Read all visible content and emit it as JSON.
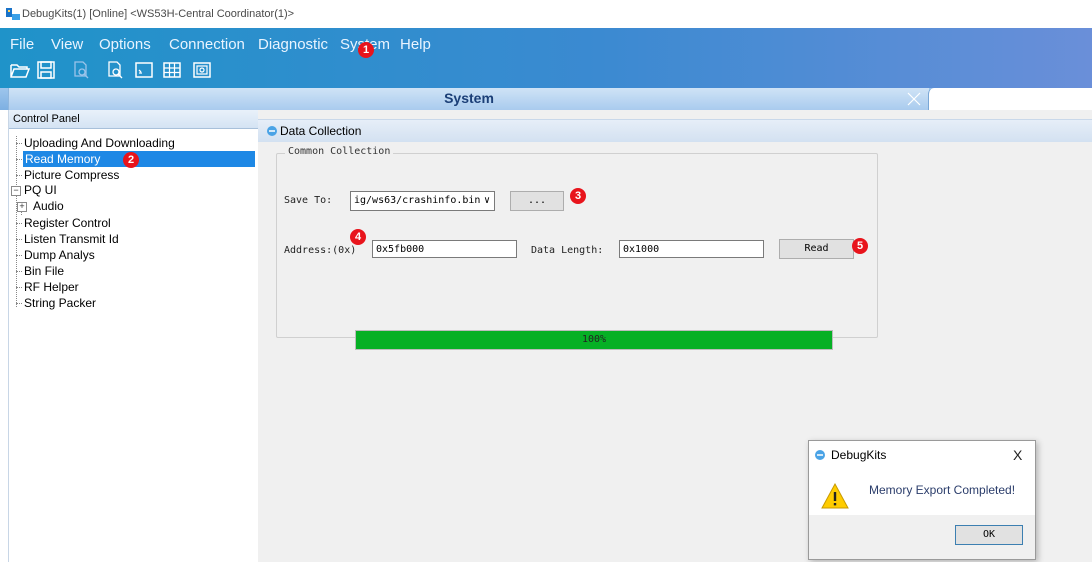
{
  "window": {
    "title": "DebugKits(1) [Online] <WS53H-Central Coordinator(1)>"
  },
  "menubar": {
    "items": [
      "File",
      "View",
      "Options",
      "Connection",
      "Diagnostic",
      "System",
      "Help"
    ]
  },
  "toolbar": {
    "icons": [
      "open-folder-icon",
      "save-icon",
      "document-disabled-icon",
      "document-export-icon",
      "terminal-icon",
      "table-icon",
      "camera-icon"
    ]
  },
  "tab": {
    "label": "System"
  },
  "control_panel": {
    "header": "Control Panel",
    "items": [
      {
        "label": "Uploading And Downloading"
      },
      {
        "label": "Read Memory",
        "selected": true
      },
      {
        "label": "Picture Compress"
      },
      {
        "label": "PQ UI",
        "expanded": true
      },
      {
        "label": "Audio",
        "collapsed": true
      },
      {
        "label": "Register Control"
      },
      {
        "label": "Listen Transmit Id"
      },
      {
        "label": "Dump Analys"
      },
      {
        "label": "Bin File"
      },
      {
        "label": "RF Helper"
      },
      {
        "label": "String Packer"
      }
    ]
  },
  "data_collection": {
    "header": "Data Collection",
    "group_label": "Common Collection",
    "save_to_label": "Save To:",
    "save_to_value": "ig/ws63/crashinfo.bin",
    "browse_label": "...",
    "address_label": "Address:(0x)",
    "address_value": "0x5fb000",
    "data_length_label": "Data Length:",
    "data_length_value": "0x1000",
    "read_label": "Read",
    "progress_text": "100%",
    "progress_value": 1.0
  },
  "annotations": [
    "1",
    "2",
    "3",
    "4",
    "5"
  ],
  "dialog": {
    "title": "DebugKits",
    "close": "X",
    "message": "Memory Export Completed!",
    "ok_label": "OK"
  },
  "colors": {
    "menubar_blue": "#1f93c9",
    "selection": "#1e88e5",
    "progress_green": "#06b025",
    "badge_red": "#e8141c"
  }
}
